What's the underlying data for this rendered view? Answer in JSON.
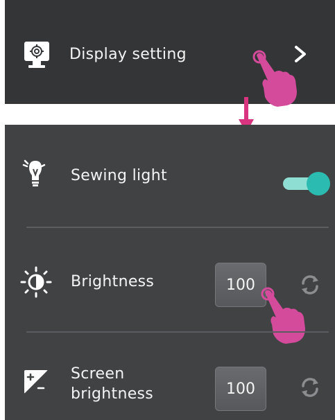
{
  "display_setting": {
    "label": "Display setting",
    "icon": "monitor-gear-icon"
  },
  "sewing_light": {
    "label": "Sewing light",
    "icon": "light-bulb-icon",
    "toggle_on": true
  },
  "brightness": {
    "label": "Brightness",
    "value": "100",
    "icon": "brightness-sun-icon"
  },
  "screen_brightness": {
    "label_line1": "Screen",
    "label_line2": "brightness",
    "value": "100",
    "icon": "screen-contrast-icon"
  },
  "colors": {
    "panel_bg": "#414244",
    "header_bg": "#343537",
    "accent_teal": "#2cbbb0",
    "pointer_pink": "#d44b9c"
  }
}
